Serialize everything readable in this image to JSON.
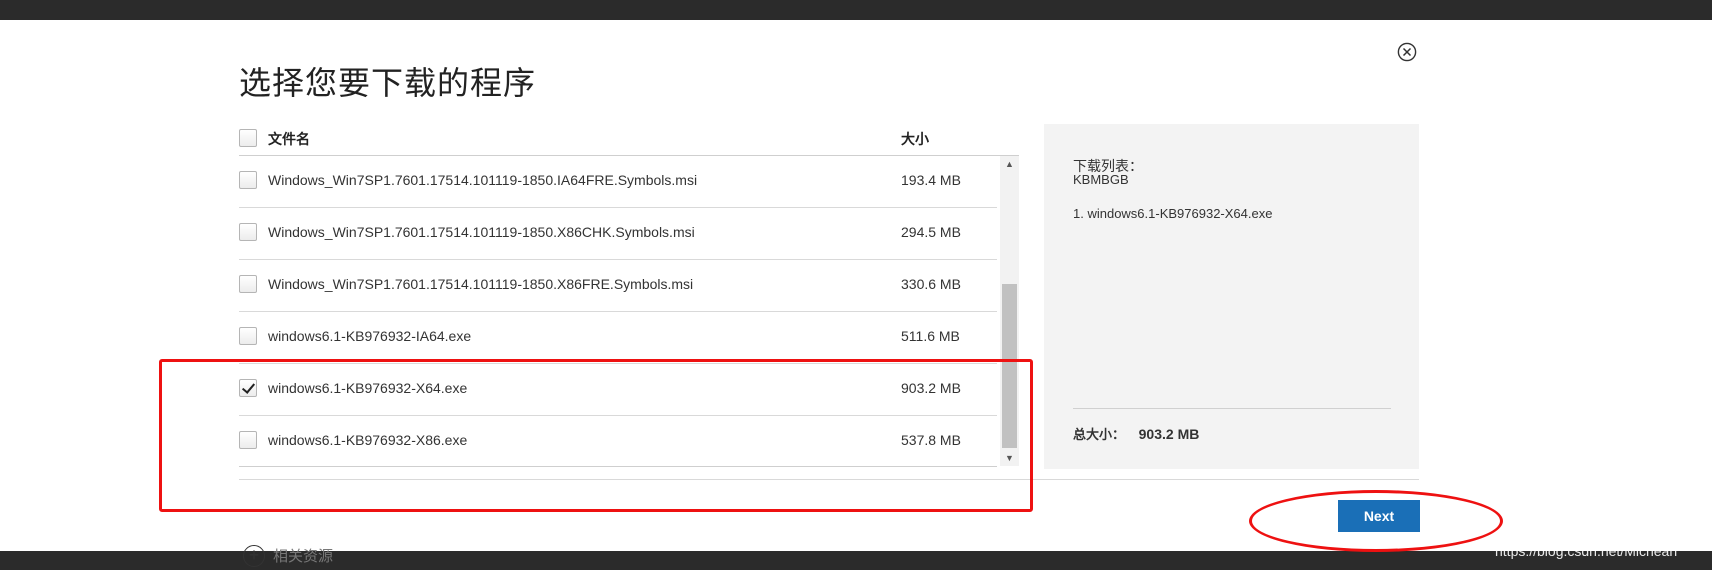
{
  "dialog": {
    "title": "选择您要下载的程序"
  },
  "file_list": {
    "header": {
      "name": "文件名",
      "size": "大小"
    },
    "rows": [
      {
        "name": "Windows_Win7SP1.7601.17514.101119-1850.IA64FRE.Symbols.msi",
        "size": "193.4 MB",
        "checked": false
      },
      {
        "name": "Windows_Win7SP1.7601.17514.101119-1850.X86CHK.Symbols.msi",
        "size": "294.5 MB",
        "checked": false
      },
      {
        "name": "Windows_Win7SP1.7601.17514.101119-1850.X86FRE.Symbols.msi",
        "size": "330.6 MB",
        "checked": false
      },
      {
        "name": "windows6.1-KB976932-IA64.exe",
        "size": "511.6 MB",
        "checked": false
      },
      {
        "name": "windows6.1-KB976932-X64.exe",
        "size": "903.2 MB",
        "checked": true
      },
      {
        "name": "windows6.1-KB976932-X86.exe",
        "size": "537.8 MB",
        "checked": false
      }
    ]
  },
  "summary": {
    "list_label": "下载列表：",
    "code": "KBMBGB",
    "items": [
      "1. windows6.1-KB976932-X64.exe"
    ],
    "total_label": "总大小：",
    "total_value": "903.2 MB"
  },
  "actions": {
    "next_label": "Next"
  },
  "related": {
    "label": "相关资源"
  },
  "watermark": "https://blog.csdn.net/Michean",
  "colors": {
    "accent": "#1a6fb7",
    "annotation": "#e11111",
    "side_panel_bg": "#f3f3f3"
  }
}
